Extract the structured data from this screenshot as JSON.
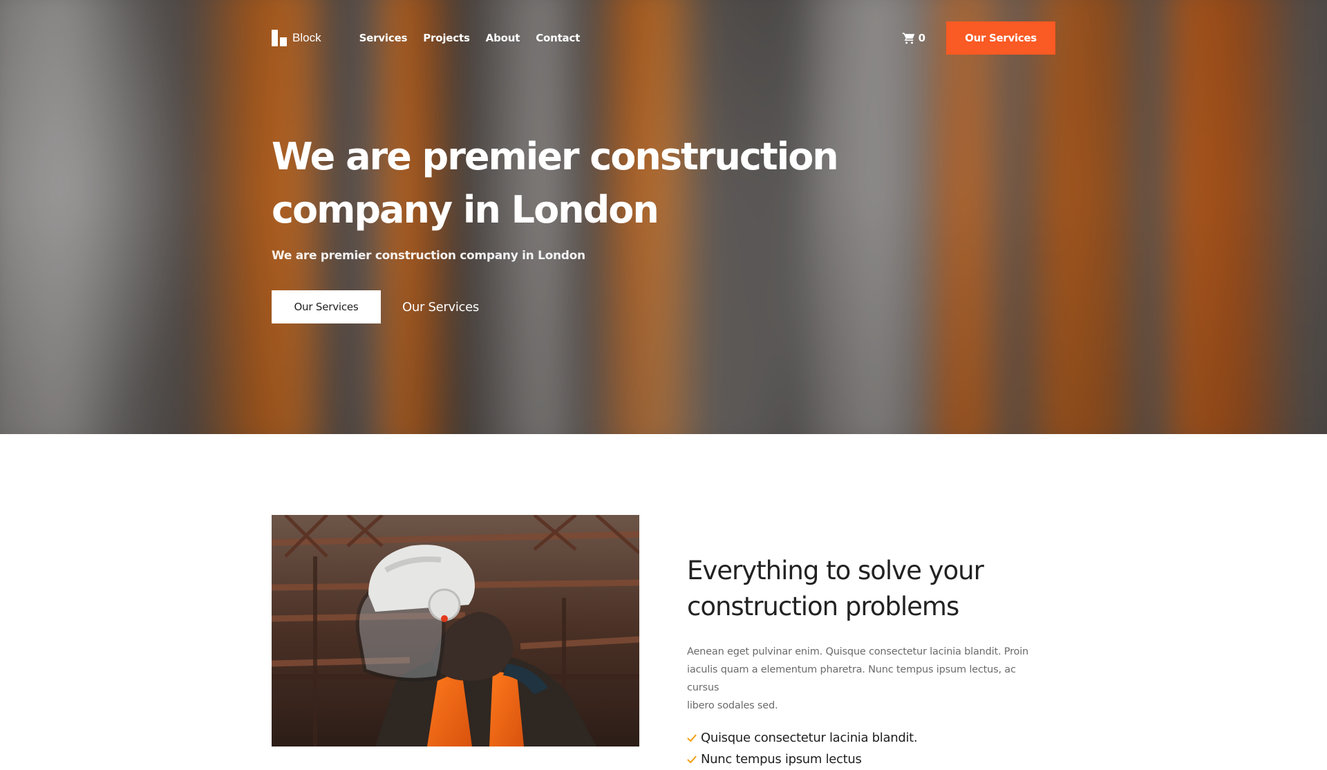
{
  "nav": {
    "brand": "Block",
    "links": [
      "Services",
      "Projects",
      "About",
      "Contact"
    ],
    "cart_count": "0",
    "cta_label": "Our Services"
  },
  "hero": {
    "title_line1": "We are premier construction",
    "title_line2": "company in London",
    "subtitle": "We are premier construction company in London",
    "primary_button": "Our Services",
    "secondary_link": "Our Services"
  },
  "feature": {
    "title_line1": "Everything to solve your",
    "title_line2": "construction problems",
    "body_line1": "Aenean eget pulvinar enim. Quisque consectetur lacinia blandit. Proin",
    "body_line2": "iaculis quam a elementum pharetra. Nunc tempus ipsum lectus, ac cursus",
    "body_line3": "libero sodales sed.",
    "items": [
      "Quisque consectetur lacinia blandit.",
      "Nunc tempus ipsum lectus"
    ]
  },
  "colors": {
    "accent": "#fa5a24",
    "check": "#f2a31b",
    "text_dark": "#222222",
    "text_muted": "#6b6b6b"
  },
  "icons": {
    "cart": "cart-icon",
    "check": "check-icon",
    "logo": "logo-icon"
  }
}
